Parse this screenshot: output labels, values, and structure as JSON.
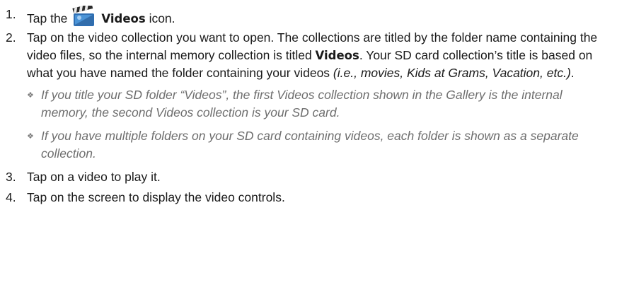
{
  "steps": [
    {
      "number": "1.",
      "before": "Tap the",
      "icon": "video-clapperboard-icon",
      "bold": "Videos",
      "after": " icon."
    },
    {
      "number": "2.",
      "text1": "Tap on the video collection you want to open. The collections are titled by the folder name containing the video files, so the internal memory collection is titled ",
      "bold": "Videos",
      "text2": ". Your SD card collection’s title is based on what you have named the folder containing your videos ",
      "italic": "(i.e., movies, Kids at Grams, Vacation, etc.)",
      "text3": ".",
      "bullets": [
        "If you title your SD folder “Videos”, the first Videos collection shown in the Gallery is the internal memory, the second Videos collection is your SD card.",
        "If you have multiple folders on your SD card containing videos, each folder is shown as a separate collection."
      ],
      "bullet_glyph": "❖"
    },
    {
      "number": "3.",
      "text": "Tap on a video to play it."
    },
    {
      "number": "4.",
      "text": "Tap on the screen to display the video controls."
    }
  ],
  "colors": {
    "text": "#1a1a1a",
    "note_text": "#6e6e6e"
  }
}
